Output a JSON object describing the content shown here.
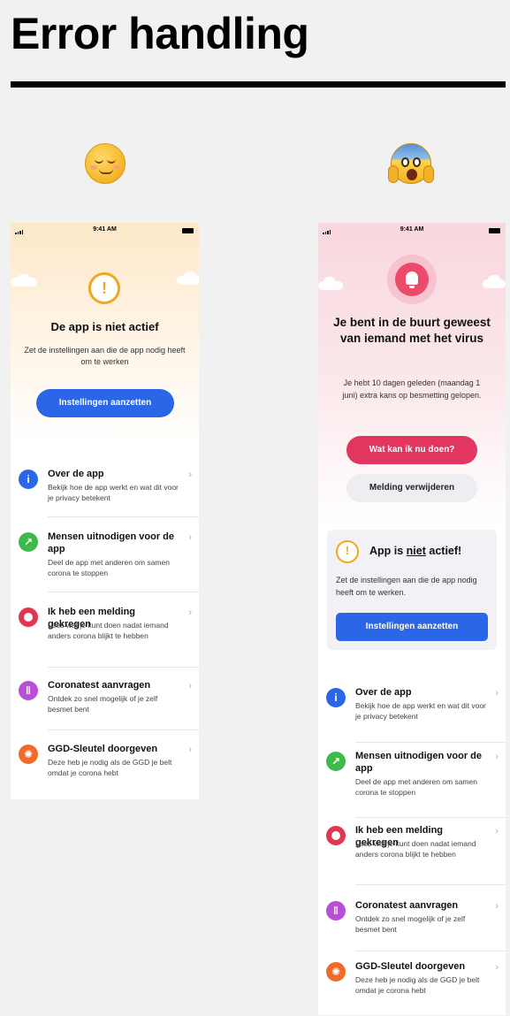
{
  "page": {
    "title": "Error handling"
  },
  "colors": {
    "blue": "#2b66e8",
    "pink": "#e0365f",
    "orange": "#f0a81c",
    "green": "#3fb94a",
    "purple": "#b84fd6",
    "red": "#e0364f",
    "grey_button": "#eeeef2"
  },
  "left_phone": {
    "status_time": "9:41 AM",
    "icon": "warning-icon",
    "title": "De app is niet actief",
    "text": "Zet de instellingen aan die de app nodig heeft om te werken",
    "button": "Instellingen aanzetten"
  },
  "right_phone": {
    "status_time": "9:41 AM",
    "icon": "notification-bell-icon",
    "title": "Je bent in de buurt geweest van iemand met het virus",
    "text": "Je hebt 10 dagen geleden (maandag 1 juni) extra kans op besmetting gelopen.",
    "primary_button": "Wat kan ik nu doen?",
    "secondary_button": "Melding verwijderen",
    "card": {
      "title_prefix": "App is ",
      "title_emphasis": "niet",
      "title_suffix": " actief!",
      "text": "Zet de instellingen aan die de app nodig heeft om te werken.",
      "button": "Instellingen aanzetten"
    }
  },
  "menu": [
    {
      "icon": "info-icon",
      "glyph": "i",
      "title": "Over de app",
      "desc": "Bekijk hoe de app werkt en wat dit voor je privacy betekent"
    },
    {
      "icon": "share-icon",
      "glyph": "↗",
      "title": "Mensen uitnodigen voor de app",
      "desc": "Deel de app met anderen om samen corona te stoppen"
    },
    {
      "icon": "notification-icon",
      "glyph": "",
      "title": "Ik heb een melding gekregen",
      "desc": "Lees wat je kunt doen nadat iemand anders corona blijkt te hebben"
    },
    {
      "icon": "test-tube-icon",
      "glyph": "‖",
      "title": "Coronatest aanvragen",
      "desc": "Ontdek zo snel mogelijk of je zelf besmet bent"
    },
    {
      "icon": "virus-icon",
      "glyph": "✺",
      "title": "GGD-Sleutel doorgeven",
      "desc": "Deze heb je nodig als de GGD je belt omdat je corona hebt"
    }
  ]
}
